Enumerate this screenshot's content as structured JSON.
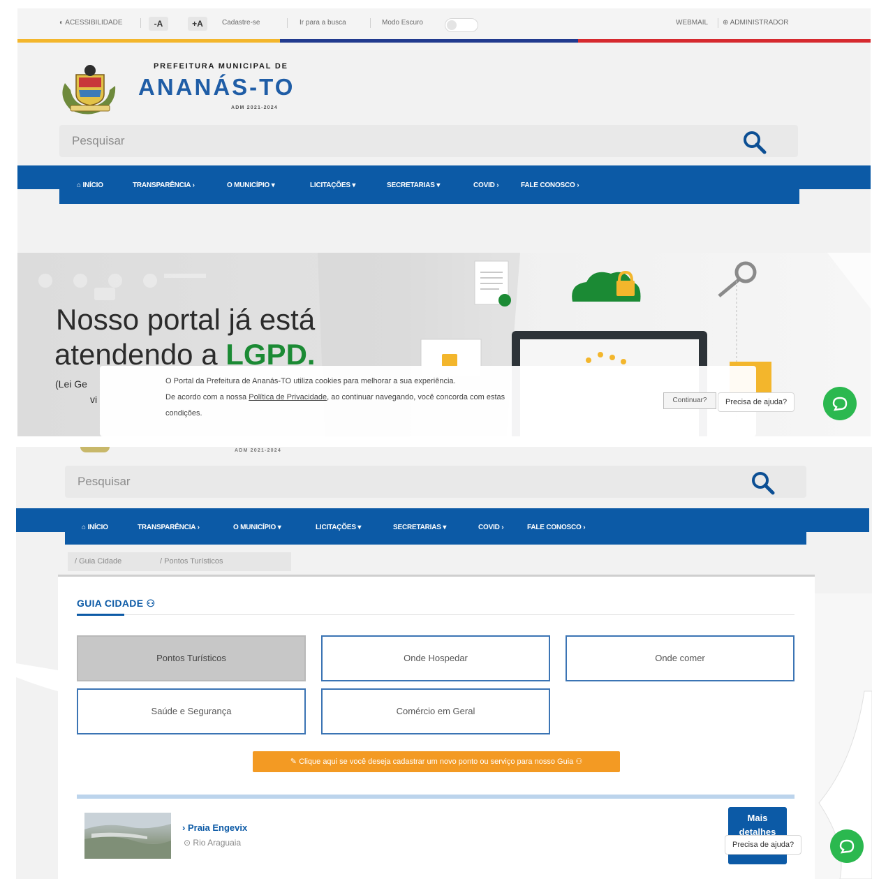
{
  "accessibility_bar": {
    "accessibility": "ACESSIBILIDADE",
    "font_decrease": "-A",
    "font_increase": "+A",
    "register": "Cadastre-se",
    "go_to_search": "Ir para a busca",
    "dark_mode": "Modo Escuro",
    "webmail": "WEBMAIL",
    "admin": "ADMINISTRADOR"
  },
  "brand": {
    "line1": "PREFEITURA MUNICIPAL DE",
    "line2": "ANANÁS-TO",
    "line3": "ADM 2021-2024"
  },
  "search": {
    "placeholder": "Pesquisar"
  },
  "nav": {
    "items": [
      "INÍCIO",
      "TRANSPARÊNCIA",
      "O MUNICÍPIO",
      "LICITAÇÕES",
      "SECRETARIAS",
      "COVID",
      "FALE CONOSCO"
    ]
  },
  "hero": {
    "line1": "Nosso portal já está",
    "line2_prefix": "atendendo a ",
    "line2_highlight": "LGPD.",
    "line3": "(Lei Ge",
    "line4": "vi"
  },
  "cookie": {
    "line1": "O Portal da Prefeitura de Ananás-TO utiliza cookies para melhorar a sua experiência.",
    "line2_prefix": "De acordo com a nossa ",
    "line2_link": "Política de Privacidade",
    "line2_suffix": ", ao continuar navegando, você concorda com estas",
    "line3": "condições.",
    "button": "Continuar?"
  },
  "help": {
    "label": "Precisa de ajuda?"
  },
  "breadcrumb": {
    "items": [
      "Guia Cidade",
      "Pontos Turísticos"
    ]
  },
  "guide": {
    "title": "GUIA CIDADE",
    "categories": [
      "Pontos Turísticos",
      "Onde Hospedar",
      "Onde comer",
      "Saúde e Segurança",
      "Comércio em Geral"
    ],
    "cta": "Clique aqui se você deseja cadastrar um novo ponto ou serviço para nosso Guia"
  },
  "listing": {
    "title": "Praia Engevix",
    "location": "Rio Araguaia",
    "more_button": "Mais detalhes"
  },
  "colors": {
    "nav_blue": "#0c5aa6",
    "brand_blue": "#1f5da6",
    "lgpd_green": "#1b8a34",
    "cta_orange": "#f39a23",
    "whatsapp_green": "#2bb84f",
    "bar_yellow": "#f3b62c",
    "bar_navy": "#213a8e",
    "bar_red": "#d62a2f"
  }
}
